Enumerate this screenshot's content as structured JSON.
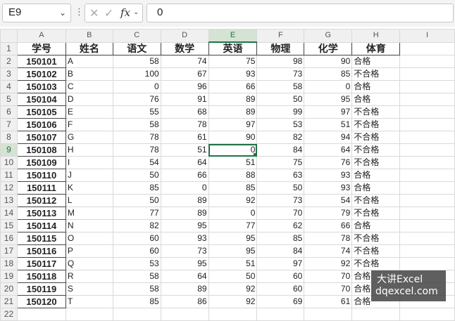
{
  "formula_bar": {
    "name_box": "E9",
    "name_box_arrow": "⌄",
    "dots": "⋮",
    "cancel_icon": "✕",
    "enter_icon": "✓",
    "fx_label": "fx",
    "fx_arrow": "⌄",
    "formula_value": "0"
  },
  "columns": [
    "A",
    "B",
    "C",
    "D",
    "E",
    "F",
    "G",
    "H",
    "I"
  ],
  "selected_column": "E",
  "selected_row": "9",
  "header_row": [
    "学号",
    "姓名",
    "语文",
    "数学",
    "英语",
    "物理",
    "化学",
    "体育"
  ],
  "rows": [
    [
      "150101",
      "A",
      "58",
      "74",
      "75",
      "98",
      "90",
      "合格"
    ],
    [
      "150102",
      "B",
      "100",
      "67",
      "93",
      "73",
      "85",
      "不合格"
    ],
    [
      "150103",
      "C",
      "0",
      "96",
      "66",
      "58",
      "0",
      "合格"
    ],
    [
      "150104",
      "D",
      "76",
      "91",
      "89",
      "50",
      "95",
      "合格"
    ],
    [
      "150105",
      "E",
      "55",
      "68",
      "89",
      "99",
      "97",
      "不合格"
    ],
    [
      "150106",
      "F",
      "58",
      "78",
      "97",
      "53",
      "51",
      "不合格"
    ],
    [
      "150107",
      "G",
      "78",
      "61",
      "90",
      "82",
      "94",
      "不合格"
    ],
    [
      "150108",
      "H",
      "78",
      "51",
      "0",
      "84",
      "64",
      "不合格"
    ],
    [
      "150109",
      "I",
      "54",
      "64",
      "51",
      "75",
      "76",
      "不合格"
    ],
    [
      "150110",
      "J",
      "50",
      "66",
      "88",
      "63",
      "93",
      "合格"
    ],
    [
      "150111",
      "K",
      "85",
      "0",
      "85",
      "50",
      "93",
      "合格"
    ],
    [
      "150112",
      "L",
      "50",
      "89",
      "92",
      "73",
      "54",
      "不合格"
    ],
    [
      "150113",
      "M",
      "77",
      "89",
      "0",
      "70",
      "79",
      "不合格"
    ],
    [
      "150114",
      "N",
      "82",
      "95",
      "77",
      "62",
      "66",
      "合格"
    ],
    [
      "150115",
      "O",
      "60",
      "93",
      "95",
      "85",
      "78",
      "不合格"
    ],
    [
      "150116",
      "P",
      "60",
      "73",
      "95",
      "84",
      "74",
      "不合格"
    ],
    [
      "150117",
      "Q",
      "53",
      "95",
      "51",
      "97",
      "92",
      "不合格"
    ],
    [
      "150118",
      "R",
      "58",
      "64",
      "50",
      "60",
      "70",
      "合格"
    ],
    [
      "150119",
      "S",
      "58",
      "89",
      "92",
      "60",
      "70",
      "合格"
    ],
    [
      "150120",
      "T",
      "85",
      "86",
      "92",
      "69",
      "61",
      "合格"
    ]
  ],
  "row_numbers": [
    "1",
    "2",
    "3",
    "4",
    "5",
    "6",
    "7",
    "8",
    "9",
    "10",
    "11",
    "12",
    "13",
    "14",
    "15",
    "16",
    "17",
    "18",
    "19",
    "20",
    "21",
    "22"
  ],
  "watermark": {
    "line1": "大讲Excel",
    "line2": "dqexcel.com"
  },
  "colors": {
    "accent": "#217346",
    "header_bg": "#f0f0f0"
  }
}
